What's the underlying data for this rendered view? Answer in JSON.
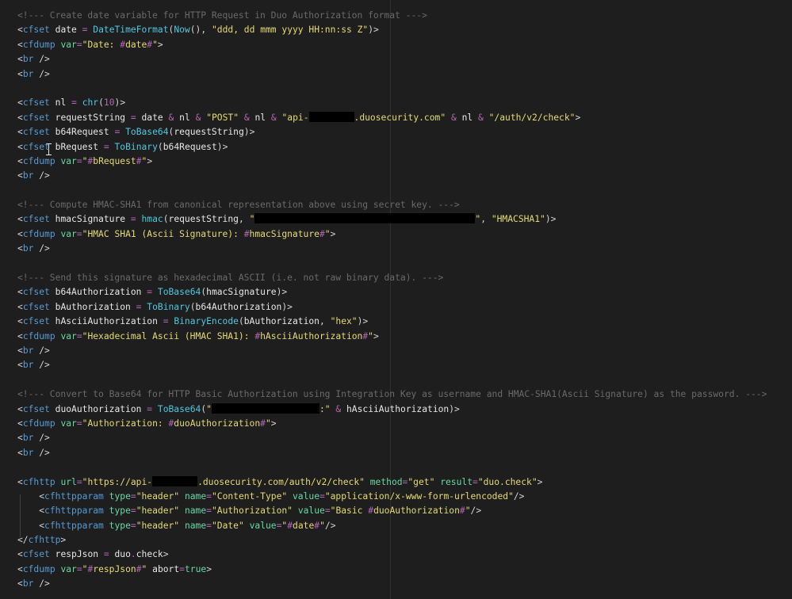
{
  "editor": {
    "lines": [
      {
        "text": "<!--- Create date variable for HTTP Request in Duo Authorization format --->"
      },
      {
        "text": "<cfset date = DateTimeFormat(Now(), \"ddd, dd mmm yyyy HH:nn:ss Z\")>"
      },
      {
        "text": "<cfdump var=\"Date: #date#\">"
      },
      {
        "text": "<br />"
      },
      {
        "text": "<br />"
      },
      {
        "text": ""
      },
      {
        "text": "<cfset nl = chr(10)>"
      },
      {
        "text": "<cfset requestString = date & nl & \"POST\" & nl & \"api-[redacted].duosecurity.com\" & nl & \"/auth/v2/check\">"
      },
      {
        "text": "<cfset b64Request = ToBase64(requestString)>"
      },
      {
        "text": "<cfset bRequest = ToBinary(b64Request)>"
      },
      {
        "text": "<cfdump var=\"#bRequest#\">"
      },
      {
        "text": "<br />"
      },
      {
        "text": ""
      },
      {
        "text": "<!--- Compute HMAC-SHA1 from canonical representation above using secret key. --->"
      },
      {
        "text": "<cfset hmacSignature = hmac(requestString, \"[redacted]\", \"HMACSHA1\")>"
      },
      {
        "text": "<cfdump var=\"HMAC SHA1 (Ascii Signature): #hmacSignature#\">"
      },
      {
        "text": "<br />"
      },
      {
        "text": ""
      },
      {
        "text": "<!--- Send this signature as hexadecimal ASCII (i.e. not raw binary data). --->"
      },
      {
        "text": "<cfset b64Authorization = ToBase64(hmacSignature)>"
      },
      {
        "text": "<cfset bAuthorization = ToBinary(b64Authorization)>"
      },
      {
        "text": "<cfset hAsciiAuthorization = BinaryEncode(bAuthorization, \"hex\")>"
      },
      {
        "text": "<cfdump var=\"Hexadecimal Ascii (HMAC SHA1): #hAsciiAuthorization#\">"
      },
      {
        "text": "<br />"
      },
      {
        "text": "<br />"
      },
      {
        "text": ""
      },
      {
        "text": "<!--- Convert to Base64 for HTTP Basic Authorization using Integration Key as username and HMAC-SHA1(Ascii Signature) as the password. --->"
      },
      {
        "text": "<cfset duoAuthorization = ToBase64(\"[redacted]:\" & hAsciiAuthorization)>"
      },
      {
        "text": "<cfdump var=\"Authorization: #duoAuthorization#\">"
      },
      {
        "text": "<br />"
      },
      {
        "text": "<br />"
      },
      {
        "text": ""
      },
      {
        "text": "<cfhttp url=\"https://api-[redacted].duosecurity.com/auth/v2/check\" method=\"get\" result=\"duo.check\">"
      },
      {
        "text": "    <cfhttpparam type=\"header\" name=\"Content-Type\" value=\"application/x-www-form-urlencoded\"/>"
      },
      {
        "text": "    <cfhttpparam type=\"header\" name=\"Authorization\" value=\"Basic #duoAuthorization#\"/>"
      },
      {
        "text": "    <cfhttpparam type=\"header\" name=\"Date\" value=\"#date#\"/>"
      },
      {
        "text": "</cfhttp>"
      },
      {
        "text": "<cfset respJson = duo.check>"
      },
      {
        "text": "<cfdump var=\"#respJson#\" abort=true>"
      },
      {
        "text": "<br />"
      }
    ]
  },
  "colors": {
    "background": "#1e1e1e",
    "comment": "#6a6a6a",
    "tag": "#569cd6",
    "attribute": "#9cdcfe",
    "string": "#e6db74",
    "function": "#4ec9e0",
    "operator": "#b266b2"
  },
  "icons": {
    "cursor": "text-cursor-ibeam-icon"
  }
}
